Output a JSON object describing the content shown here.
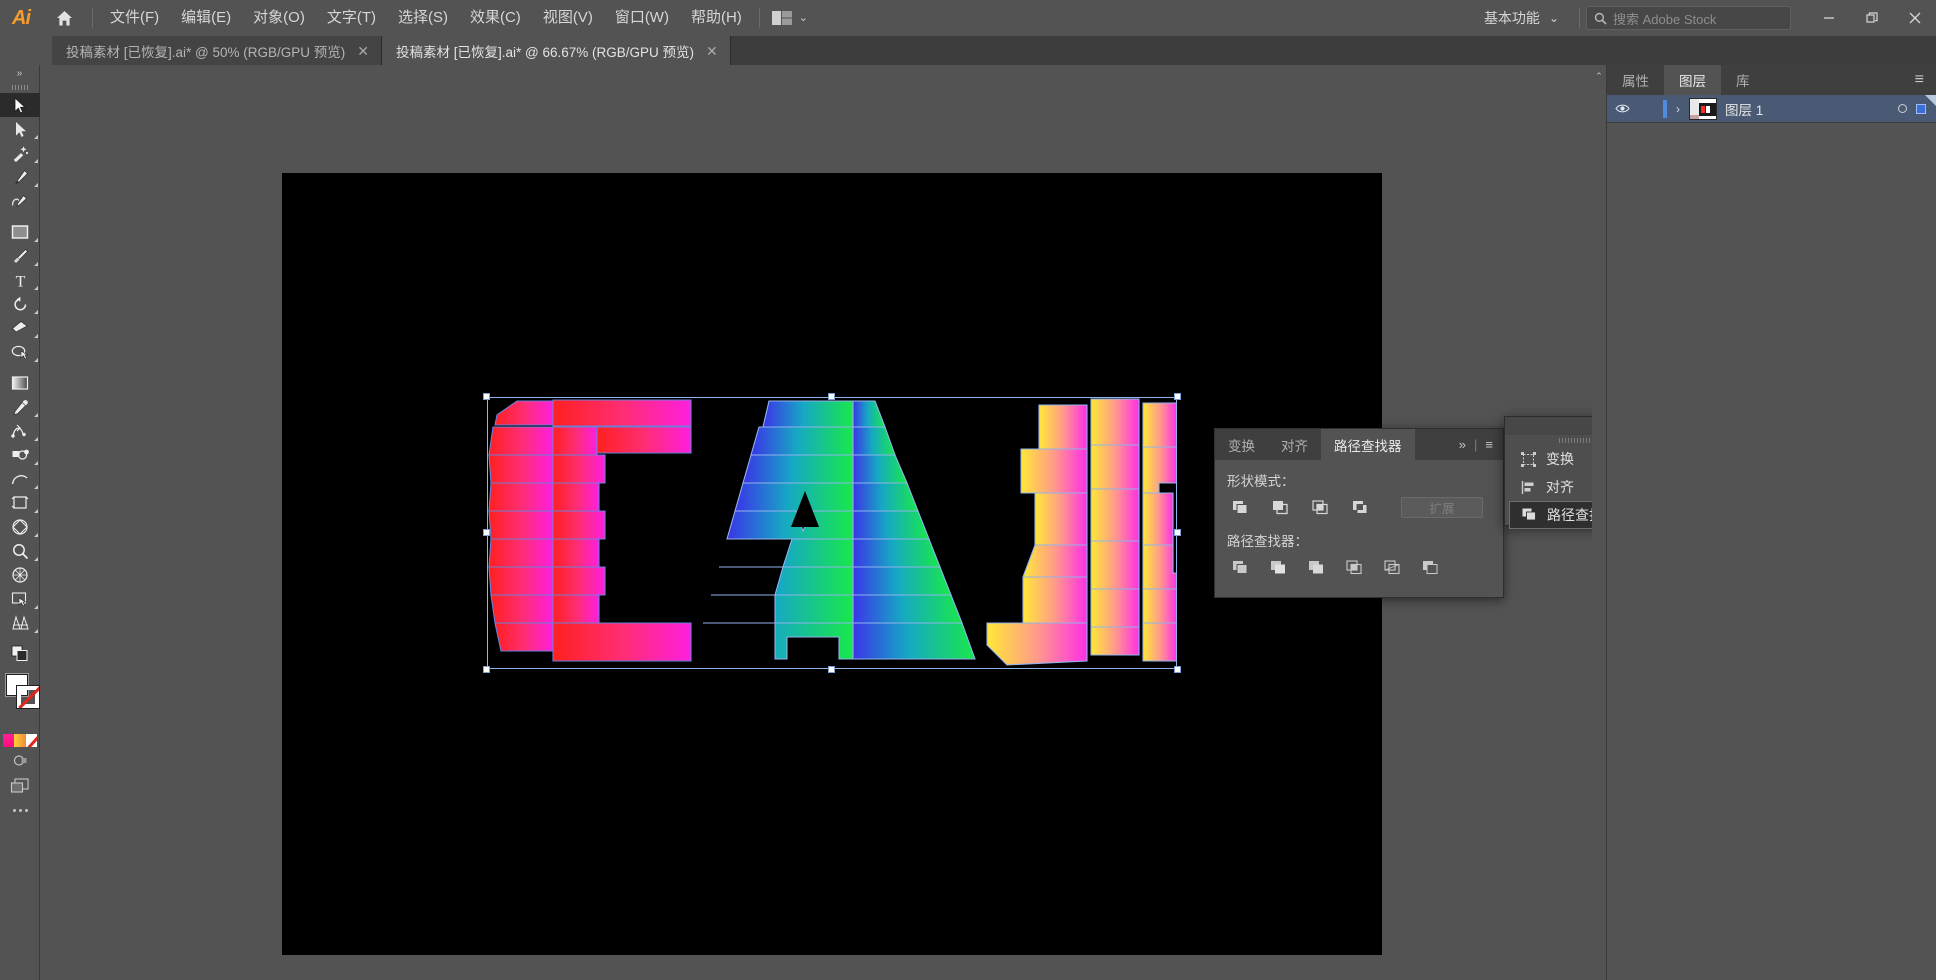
{
  "app": {
    "name": "Adobe Illustrator",
    "logo_text": "Ai"
  },
  "menubar": {
    "items": [
      {
        "label": "文件(F)",
        "name": "file"
      },
      {
        "label": "编辑(E)",
        "name": "edit"
      },
      {
        "label": "对象(O)",
        "name": "object"
      },
      {
        "label": "文字(T)",
        "name": "type"
      },
      {
        "label": "选择(S)",
        "name": "select"
      },
      {
        "label": "效果(C)",
        "name": "effect"
      },
      {
        "label": "视图(V)",
        "name": "view"
      },
      {
        "label": "窗口(W)",
        "name": "window"
      },
      {
        "label": "帮助(H)",
        "name": "help"
      }
    ],
    "workspace": "基本功能",
    "workspace_chevron": "⌄",
    "arrange_icon": "arrange-documents-icon",
    "search_placeholder": "搜索 Adobe Stock",
    "search_value": "",
    "window_buttons": {
      "minimize": "—",
      "restore": "❐",
      "close": "✕"
    }
  },
  "tabs": [
    {
      "title": "投稿素材 [已恢复].ai* @ 50% (RGB/GPU 预览)",
      "close": "✕",
      "active": false
    },
    {
      "title": "投稿素材 [已恢复].ai* @ 66.67% (RGB/GPU 预览)",
      "close": "✕",
      "active": true
    }
  ],
  "toolbar": {
    "collapse_label": "»",
    "tools": [
      {
        "name": "selection-tool",
        "active": true,
        "corner": false
      },
      {
        "name": "direct-selection-tool",
        "active": false,
        "corner": true
      },
      {
        "name": "magic-wand-tool",
        "active": false,
        "corner": true
      },
      {
        "name": "pen-tool",
        "active": false,
        "corner": true
      },
      {
        "name": "curvature-tool",
        "active": false,
        "corner": false
      },
      {
        "name": "rectangle-tool",
        "active": false,
        "corner": true
      },
      {
        "name": "paintbrush-tool",
        "active": false,
        "corner": true
      },
      {
        "name": "type-tool",
        "active": false,
        "corner": true
      },
      {
        "name": "rotate-tool",
        "active": false,
        "corner": true
      },
      {
        "name": "eraser-tool",
        "active": false,
        "corner": true
      },
      {
        "name": "shape-builder-tool",
        "active": false,
        "corner": true
      },
      {
        "name": "gradient-tool",
        "active": false,
        "corner": false
      },
      {
        "name": "eyedropper-tool",
        "active": false,
        "corner": true
      },
      {
        "name": "blend-tool",
        "active": false,
        "corner": true
      },
      {
        "name": "symbol-sprayer-tool",
        "active": false,
        "corner": true
      },
      {
        "name": "line-segment-tool",
        "active": false,
        "corner": true
      },
      {
        "name": "artboard-tool",
        "active": false,
        "corner": true
      },
      {
        "name": "perspective-grid-tool",
        "active": false,
        "corner": true
      },
      {
        "name": "zoom-tool",
        "active": false,
        "corner": true
      },
      {
        "name": "mesh-tool",
        "active": false,
        "corner": false
      },
      {
        "name": "slice-tool",
        "active": false,
        "corner": true
      },
      {
        "name": "column-graph-tool",
        "active": false,
        "corner": true
      }
    ],
    "swatches": {
      "fill_color": "#ffffff",
      "stroke_color": "#ffffff",
      "none_color": "#e0261c",
      "color_strip": [
        "#ff1f9a",
        "#f4a23a",
        "#ffffff"
      ]
    },
    "bottom": {
      "screen_mode": "screen-mode-icon",
      "edit_toolbar": "edit-toolbar-dots"
    }
  },
  "canvas": {
    "zoom": "66.67%",
    "artboard_bg": "#000000",
    "selection": {
      "border_color": "#8fb4ea",
      "handle_fill": "#ffffff"
    },
    "artwork": {
      "text": "CAI",
      "letters": [
        {
          "char": "C",
          "gradient_from": "#ff2020",
          "gradient_to": "#ff1fe0"
        },
        {
          "char": "A",
          "gradient_from": "#3b34e8",
          "gradient_to": "#18e84a"
        },
        {
          "char": "I",
          "gradient_from": "#ffe838",
          "gradient_to": "#ff2fe8"
        }
      ]
    }
  },
  "scrollbar": {
    "up_arrow": "▲",
    "down_arrow": "▼"
  },
  "pathfinder_panel": {
    "tabs": [
      {
        "label": "变换",
        "active": false
      },
      {
        "label": "对齐",
        "active": false
      },
      {
        "label": "路径查找器",
        "active": true
      }
    ],
    "expand_tabs_icon": "»",
    "panel_menu_icon": "≡",
    "shape_modes_label": "形状模式：",
    "shape_modes": [
      {
        "name": "unite-button"
      },
      {
        "name": "minus-front-button"
      },
      {
        "name": "intersect-button"
      },
      {
        "name": "exclude-button"
      }
    ],
    "expand_button": "扩展",
    "expand_disabled": true,
    "pathfinders_label": "路径查找器：",
    "pathfinders": [
      {
        "name": "divide-button"
      },
      {
        "name": "trim-button"
      },
      {
        "name": "merge-button"
      },
      {
        "name": "crop-button"
      },
      {
        "name": "outline-button"
      },
      {
        "name": "minus-back-button"
      }
    ]
  },
  "flyout_menu": {
    "collapse_icon": "••",
    "close_icon": "✕",
    "items": [
      {
        "label": "变换",
        "icon": "transform-icon",
        "selected": false
      },
      {
        "label": "对齐",
        "icon": "align-icon",
        "selected": false
      },
      {
        "label": "路径查找器",
        "icon": "pathfinder-icon",
        "selected": true
      }
    ]
  },
  "right_dock": {
    "collapse_icon": "⌃",
    "tabs": [
      {
        "label": "属性",
        "active": false
      },
      {
        "label": "图层",
        "active": true
      },
      {
        "label": "库",
        "active": false
      }
    ],
    "panel_menu_icon": "≡",
    "layers": [
      {
        "name": "图层 1",
        "visible": true,
        "expand_icon": "›",
        "target_icon": "target-circle",
        "selection_color": "#3a6fd8"
      }
    ]
  }
}
